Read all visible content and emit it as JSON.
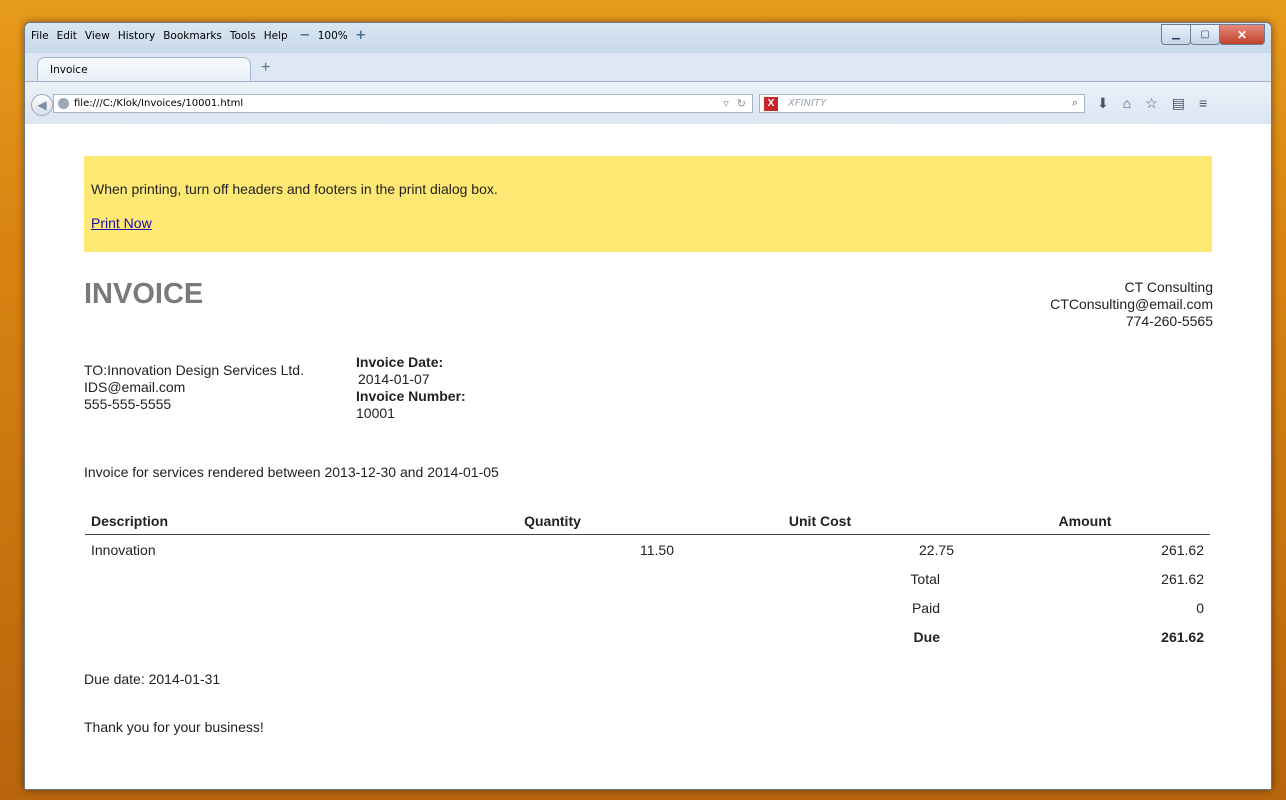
{
  "browser": {
    "menu": [
      "File",
      "Edit",
      "View",
      "History",
      "Bookmarks",
      "Tools",
      "Help"
    ],
    "zoom": "100%",
    "tab_title": "Invoice",
    "url": "file:///C:/Klok/Invoices/10001.html",
    "search_placeholder": "XFINITY",
    "search_badge": "X"
  },
  "page": {
    "notice_text": "When printing, turn off headers and footers in the print dialog box.",
    "print_link": "Print Now",
    "title": "INVOICE",
    "from": {
      "name": "CT Consulting",
      "email": "CTConsulting@email.com",
      "phone": "774-260-5565"
    },
    "to": {
      "name": "TO:Innovation Design Services Ltd.",
      "email": "IDS@email.com",
      "phone": "555-555-5555"
    },
    "invoice_date_label": "Invoice Date:",
    "invoice_date": "2014-01-07",
    "invoice_number_label": "Invoice Number:",
    "invoice_number": "10001",
    "services_text": "Invoice for services rendered between 2013-12-30 and 2014-01-05",
    "table": {
      "headers": [
        "Description",
        "Quantity",
        "Unit Cost",
        "Amount"
      ],
      "rows": [
        {
          "description": "Innovation",
          "quantity": "11.50",
          "unit_cost": "22.75",
          "amount": "261.62"
        }
      ],
      "total_label": "Total",
      "total": "261.62",
      "paid_label": "Paid",
      "paid": "0",
      "due_label": "Due",
      "due": "261.62"
    },
    "due_date": "Due date: 2014-01-31",
    "thanks": "Thank you for your business!"
  },
  "colors": {
    "notice_bg": "#ffe873",
    "title": "#7a7a7a",
    "link": "#1a0dab"
  }
}
